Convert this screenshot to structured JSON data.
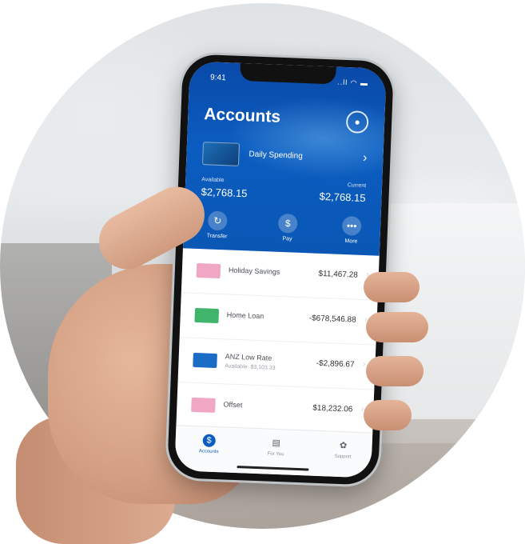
{
  "status": {
    "time": "9:41",
    "icons": "..ll ◠ ▬"
  },
  "header": {
    "title": "Accounts",
    "primary_account": "Daily Spending",
    "available_label": "Available",
    "available_value": "$2,768.15",
    "current_label": "Current",
    "current_value": "$2,768.15"
  },
  "actions": [
    {
      "label": "Transfer",
      "icon": "↻"
    },
    {
      "label": "Pay",
      "icon": "$"
    },
    {
      "label": "More",
      "icon": "•••"
    }
  ],
  "accounts": [
    {
      "name": "Holiday Savings",
      "sub": "",
      "amount": "$11,467.28",
      "color": "#f0a7c4"
    },
    {
      "name": "Home Loan",
      "sub": "",
      "amount": "-$678,546.88",
      "color": "#3fb46a"
    },
    {
      "name": "ANZ Low Rate",
      "sub": "Available: $3,103.33",
      "amount": "-$2,896.67",
      "color": "#1b6cc4"
    },
    {
      "name": "Offset",
      "sub": "",
      "amount": "$18,232.06",
      "color": "#f0a7c4"
    }
  ],
  "tabs": [
    {
      "label": "Accounts",
      "icon": "$"
    },
    {
      "label": "For You",
      "icon": "▤"
    },
    {
      "label": "Support",
      "icon": "✿"
    }
  ]
}
